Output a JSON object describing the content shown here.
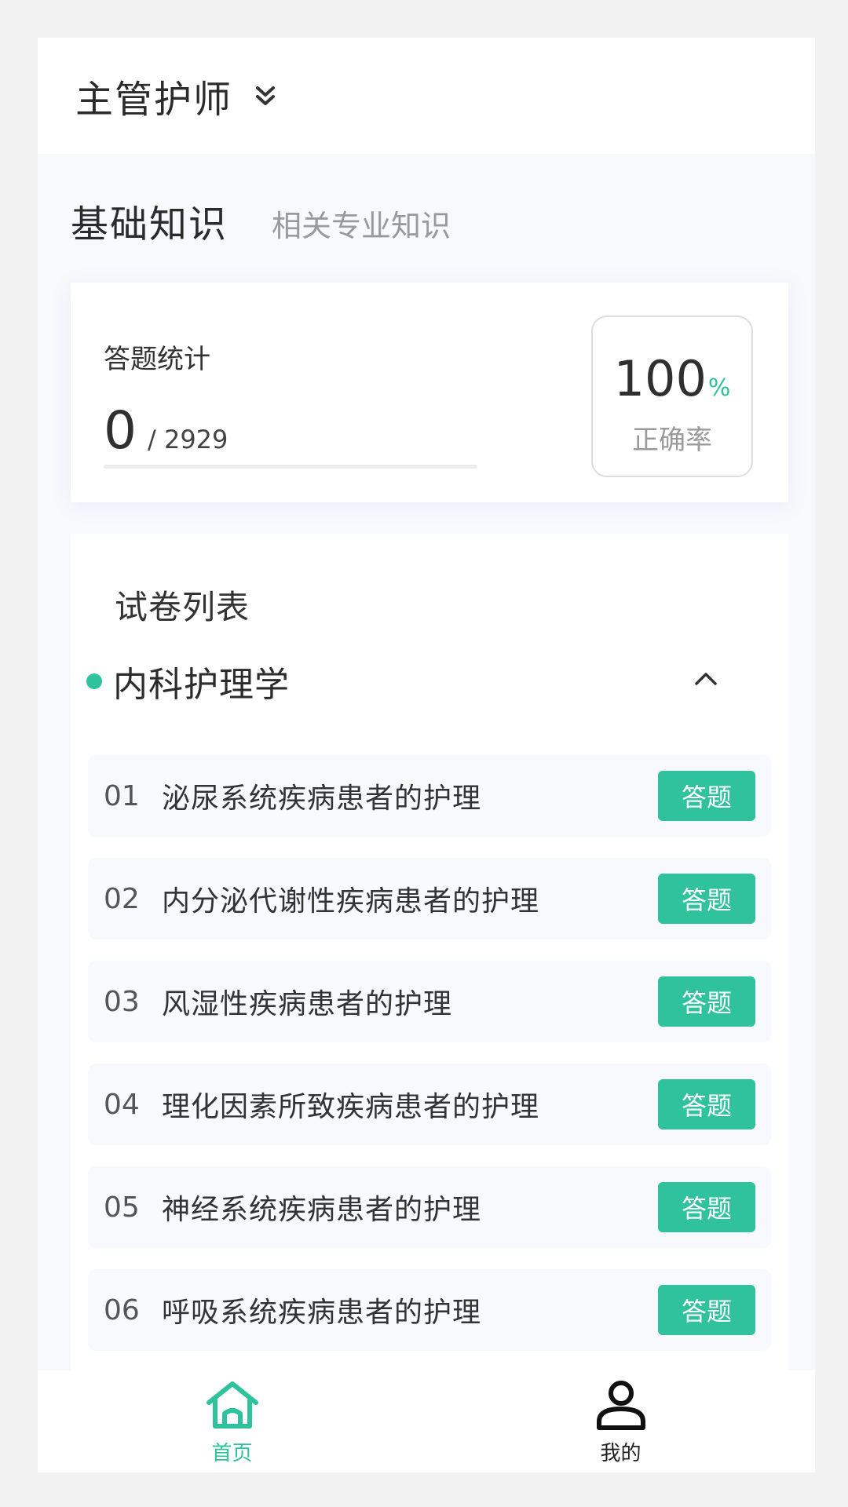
{
  "header": {
    "title": "主管护师",
    "chevron_icon": "double-chevron-down-icon"
  },
  "subject_tabs": {
    "active": "基础知识",
    "inactive": "相关专业知识"
  },
  "stats": {
    "label": "答题统计",
    "answered": "0",
    "total": "/ 2929",
    "accuracy_value": "100",
    "accuracy_unit": "%",
    "accuracy_label": "正确率"
  },
  "paper_list": {
    "title": "试卷列表",
    "category": {
      "title": "内科护理学",
      "toggle_icon": "chevron-up-icon",
      "expanded": true
    },
    "items": [
      {
        "index": "01",
        "title": "泌尿系统疾病患者的护理",
        "button": "答题"
      },
      {
        "index": "02",
        "title": "内分泌代谢性疾病患者的护理",
        "button": "答题"
      },
      {
        "index": "03",
        "title": "风湿性疾病患者的护理",
        "button": "答题"
      },
      {
        "index": "04",
        "title": "理化因素所致疾病患者的护理",
        "button": "答题"
      },
      {
        "index": "05",
        "title": "神经系统疾病患者的护理",
        "button": "答题"
      },
      {
        "index": "06",
        "title": "呼吸系统疾病患者的护理",
        "button": "答题"
      }
    ]
  },
  "bottom_nav": {
    "home": {
      "label": "首页",
      "icon": "home-icon",
      "active": true
    },
    "me": {
      "label": "我的",
      "icon": "user-icon",
      "active": false
    }
  },
  "colors": {
    "accent": "#2fc29c",
    "background": "#f7f9fd"
  }
}
